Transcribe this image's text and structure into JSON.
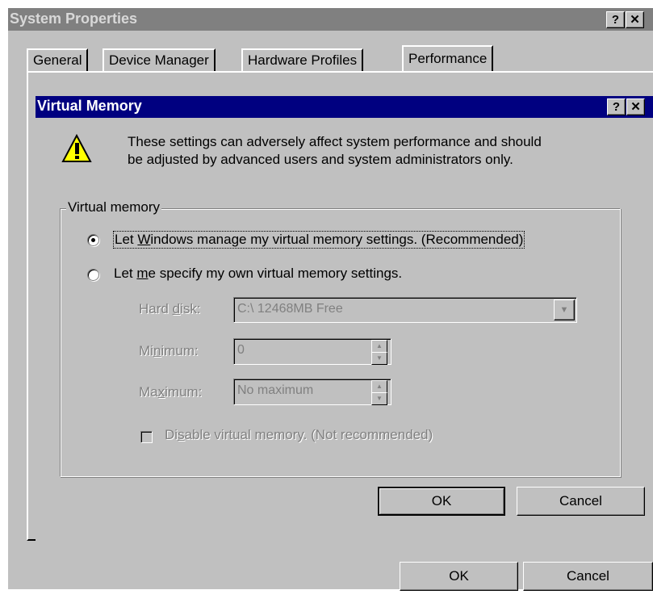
{
  "window": {
    "title": "System Properties",
    "help_label": "?",
    "close_label": "✕",
    "tabs": [
      {
        "label": "General"
      },
      {
        "label": "Device Manager"
      },
      {
        "label": "Hardware Profiles"
      },
      {
        "label": "Performance",
        "active": true
      }
    ],
    "ok_label": "OK",
    "cancel_label": "Cancel"
  },
  "dialog": {
    "title": "Virtual Memory",
    "help_label": "?",
    "close_label": "✕",
    "warning_text_1": "These settings can adversely affect system performance and should",
    "warning_text_2": "be adjusted by advanced users and system administrators only.",
    "group_label": "Virtual memory",
    "radio_windows": {
      "pre": "Let ",
      "mnemonic": "W",
      "post": "indows manage my virtual memory settings. (Recommended)",
      "selected": true
    },
    "radio_custom": {
      "pre": "Let ",
      "mnemonic": "m",
      "post": "e specify my own virtual memory settings.",
      "selected": false
    },
    "hard_disk": {
      "pre": "Hard ",
      "mnemonic": "d",
      "post": "isk:",
      "value": "C:\\ 12468MB Free"
    },
    "minimum": {
      "pre": "Mi",
      "mnemonic": "n",
      "post": "imum:",
      "value": "0"
    },
    "maximum": {
      "pre": "Ma",
      "mnemonic": "x",
      "post": "imum:",
      "value": "No maximum"
    },
    "disable": {
      "pre": "Di",
      "mnemonic": "s",
      "post": "able virtual memory. (Not recommended)",
      "checked": false
    },
    "ok_label": "OK",
    "cancel_label": "Cancel"
  },
  "colors": {
    "face": "#c0c0c0",
    "active_title": "#000080",
    "inactive_title": "#808080",
    "warning_yellow": "#ffff00"
  }
}
